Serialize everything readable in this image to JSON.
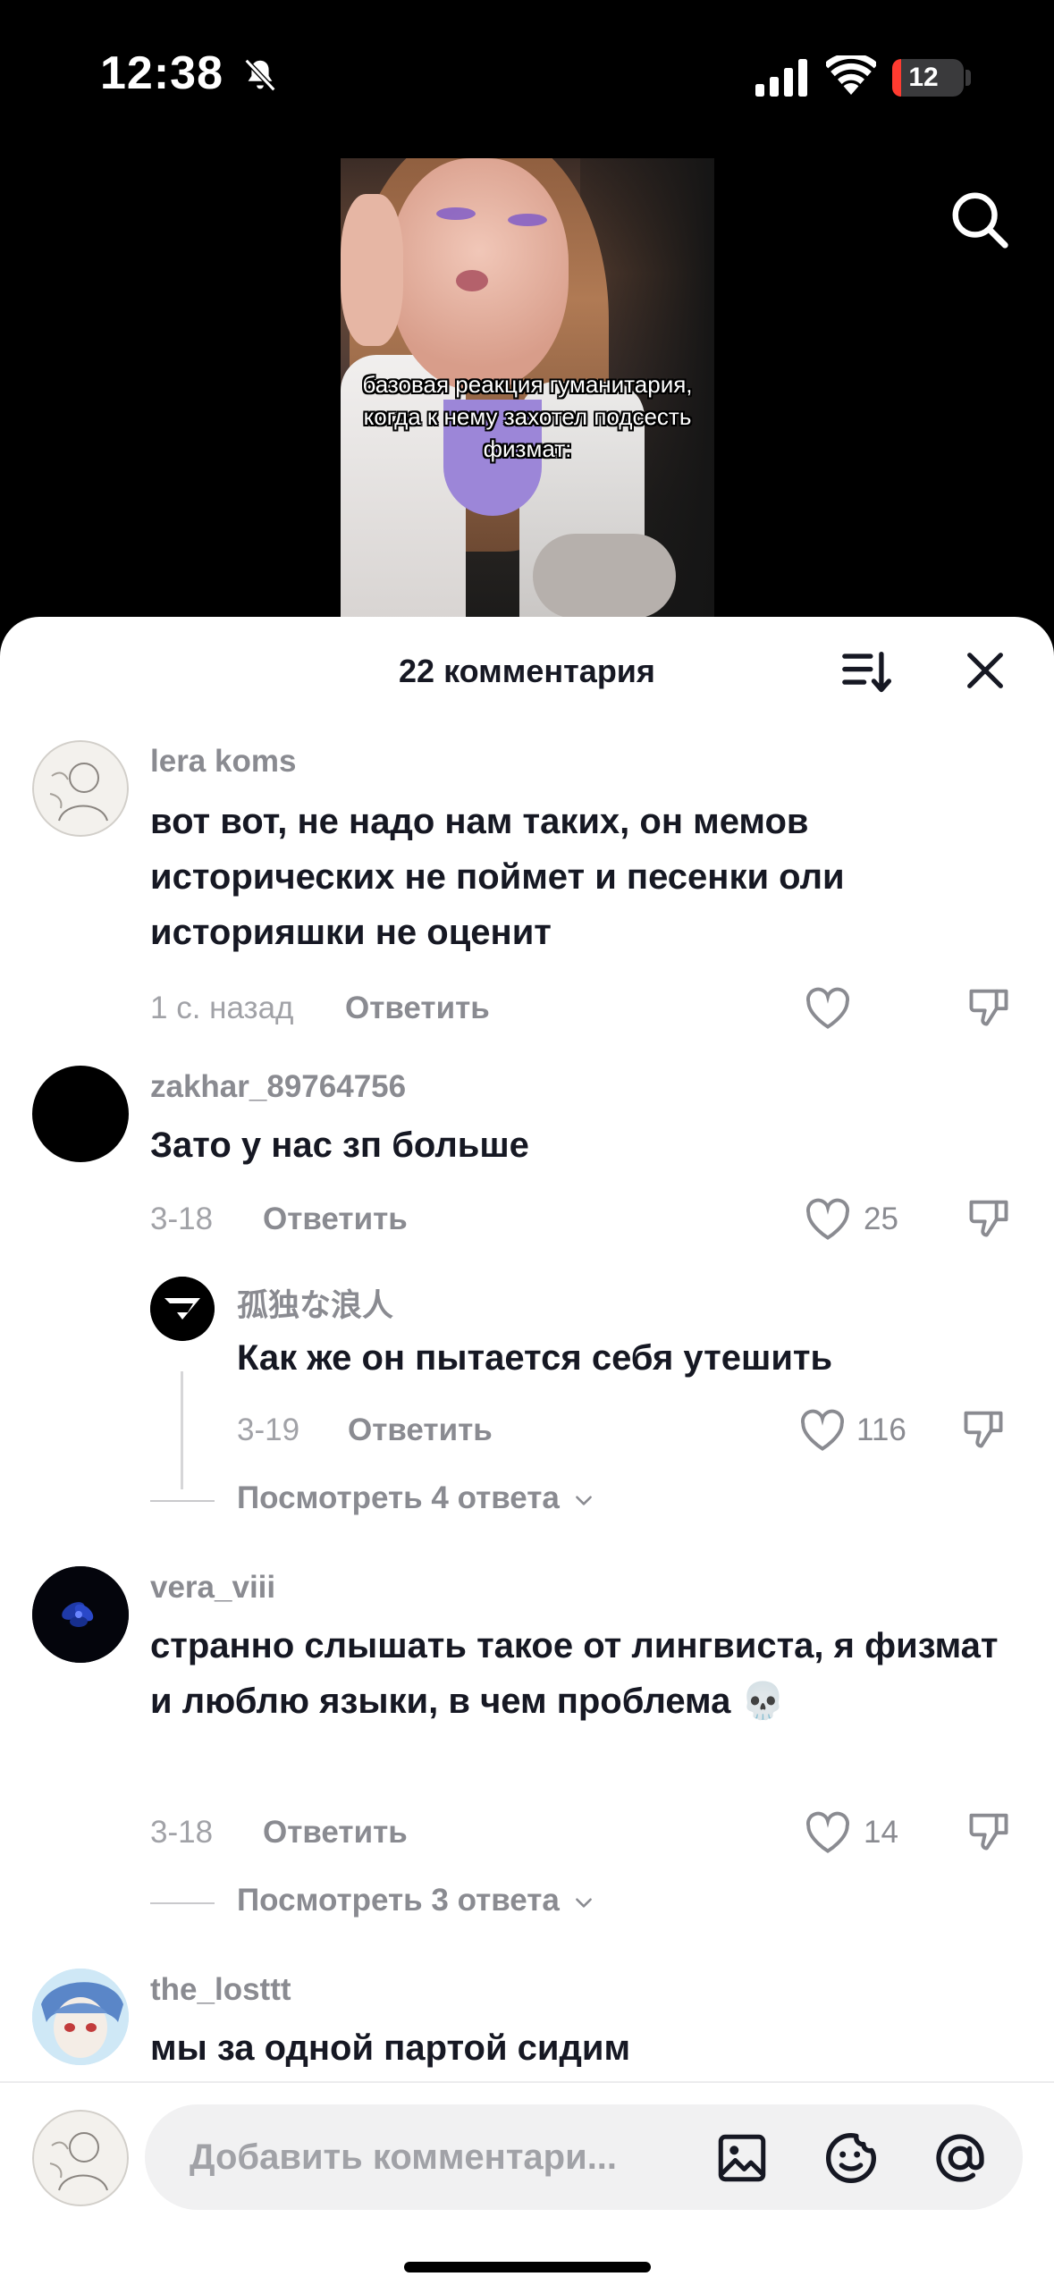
{
  "status_bar": {
    "time": "12:38",
    "battery": "12",
    "battery_level_percent": 12
  },
  "video": {
    "caption": "базовая реакция гуманитария, когда к нему захотел подсесть физмат:"
  },
  "sheet": {
    "title": "22 комментария"
  },
  "comments": [
    {
      "username": "lera koms",
      "text": "вот вот, не надо нам таких, он мемов исторических не поймет и песенки оли историяшки не оценит",
      "time": "1 с. назад",
      "reply_label": "Ответить",
      "likes": ""
    },
    {
      "username": "zakhar_89764756",
      "text": "Зато у нас зп больше",
      "time": "3-18",
      "reply_label": "Ответить",
      "likes": "25"
    },
    {
      "username": "孤独な浪人",
      "text": "Как же он пытается себя утешить",
      "time": "3-19",
      "reply_label": "Ответить",
      "likes": "116"
    },
    {
      "username": "vera_viii",
      "text": "странно слышать такое от лингвиста, я физмат и люблю языки, в чем проблема 💀",
      "time": "3-18",
      "reply_label": "Ответить",
      "likes": "14"
    },
    {
      "username": "the_losttt",
      "text": "мы за одной партой сидим"
    }
  ],
  "view_replies": [
    {
      "label": "Посмотреть 4 ответа"
    },
    {
      "label": "Посмотреть 3 ответа"
    }
  ],
  "input": {
    "placeholder": "Добавить комментари..."
  },
  "icons": {
    "status": [
      "bell-off-icon",
      "signal-icon",
      "wifi-icon",
      "battery-icon"
    ],
    "top": [
      "search-icon"
    ],
    "sheet": [
      "sort-icon",
      "close-icon",
      "heart-icon",
      "dislike-icon",
      "chevron-down-icon"
    ],
    "input": [
      "image-icon",
      "emoji-icon",
      "at-icon"
    ]
  },
  "colors": {
    "accent_battery": "#ff3b30",
    "text_primary": "#161823",
    "text_secondary": "#8a8b91"
  }
}
